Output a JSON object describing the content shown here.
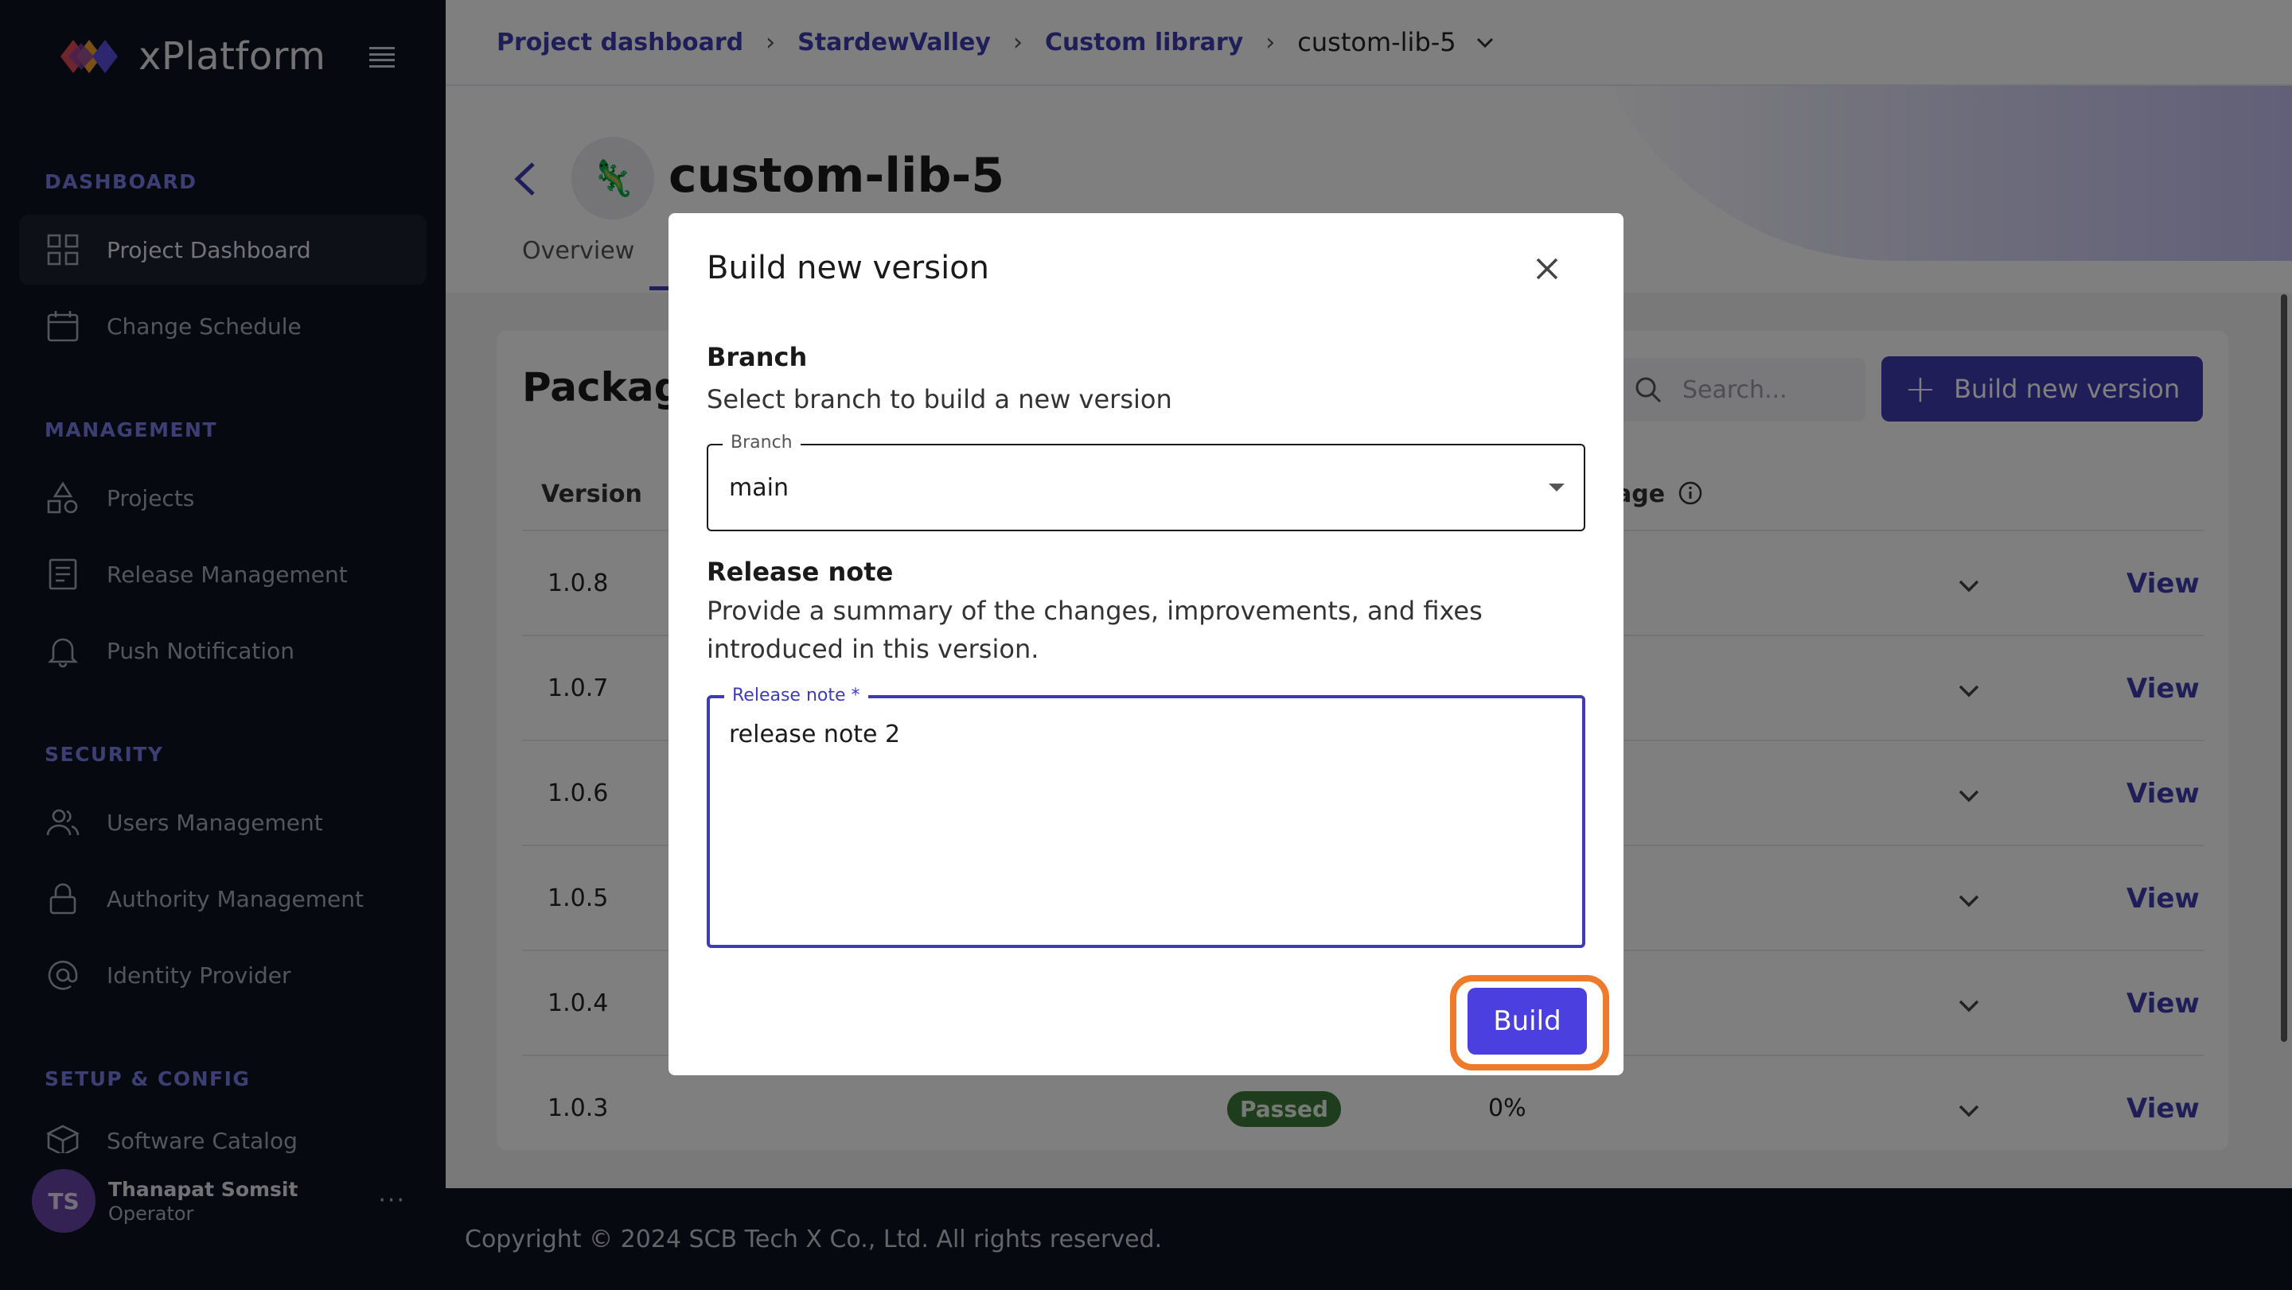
{
  "sidebar": {
    "brand": "xPlatform",
    "sections": [
      {
        "title": "DASHBOARD",
        "items": [
          {
            "label": "Project Dashboard",
            "icon": "grid-icon",
            "active": true
          },
          {
            "label": "Change Schedule",
            "icon": "calendar-icon"
          }
        ]
      },
      {
        "title": "MANAGEMENT",
        "items": [
          {
            "label": "Projects",
            "icon": "shapes-icon"
          },
          {
            "label": "Release Management",
            "icon": "document-icon"
          },
          {
            "label": "Push Notification",
            "icon": "bell-icon"
          }
        ]
      },
      {
        "title": "SECURITY",
        "items": [
          {
            "label": "Users Management",
            "icon": "users-icon"
          },
          {
            "label": "Authority Management",
            "icon": "lock-icon"
          },
          {
            "label": "Identity Provider",
            "icon": "at-icon"
          }
        ]
      },
      {
        "title": "SETUP & CONFIG",
        "items": [
          {
            "label": "Software Catalog",
            "icon": "box-icon"
          }
        ]
      }
    ],
    "user": {
      "initials": "TS",
      "name": "Thanapat Somsit",
      "role": "Operator",
      "more": "···"
    }
  },
  "breadcrumb": {
    "items": [
      "Project dashboard",
      "StardewValley",
      "Custom library"
    ],
    "current": "custom-lib-5"
  },
  "page": {
    "title": "custom-lib-5",
    "tabs": [
      "Overview"
    ]
  },
  "packages": {
    "title": "Package",
    "search_placeholder": "Search...",
    "build_button": "Build new version",
    "columns": {
      "version": "Version",
      "coverage_partial": "age"
    },
    "rows": [
      {
        "version": "1.0.8",
        "action": "View"
      },
      {
        "version": "1.0.7",
        "action": "View"
      },
      {
        "version": "1.0.6",
        "action": "View"
      },
      {
        "version": "1.0.5",
        "action": "View"
      },
      {
        "version": "1.0.4",
        "action": "View"
      },
      {
        "version": "1.0.3",
        "status": "Passed",
        "coverage": "0%",
        "action": "View"
      }
    ]
  },
  "footer": {
    "text": "Copyright © 2024 SCB Tech X Co., Ltd. All rights reserved."
  },
  "modal": {
    "title": "Build new version",
    "branch": {
      "heading": "Branch",
      "description": "Select branch to build a new version",
      "field_label": "Branch",
      "value": "main"
    },
    "release_note": {
      "heading": "Release note",
      "description": "Provide a summary of the changes, improvements, and fixes introduced in this version.",
      "field_label": "Release note *",
      "value": "release note 2"
    },
    "submit": "Build"
  },
  "colors": {
    "accent": "#3f3cb3",
    "highlight": "#ee7a2c",
    "sidebar_bg": "#0f1220"
  }
}
